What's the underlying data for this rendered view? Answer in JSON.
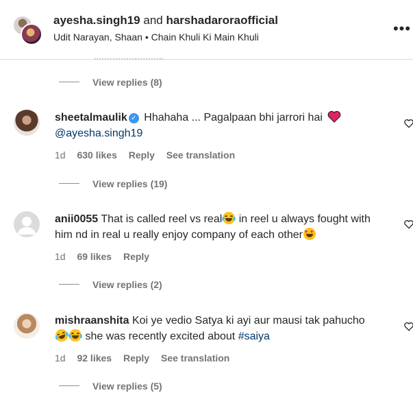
{
  "header": {
    "user1": "ayesha.singh19",
    "connector": "and",
    "user2": "harshadaroraofficial",
    "audio": "Udit Narayan, Shaan • Chain Khuli Ki Main Khuli",
    "more_icon": "more-horizontal-icon"
  },
  "replies": [
    {
      "label": "View replies (8)"
    },
    {
      "label": "View replies (19)"
    },
    {
      "label": "View replies (2)"
    },
    {
      "label": "View replies (5)"
    }
  ],
  "comments": [
    {
      "username": "sheetalmaulik",
      "verified": true,
      "text": "Hhahaha ... Pagalpaan bhi jarrori hai",
      "mention": "@ayesha.singh19",
      "age": "1d",
      "likes": "630 likes",
      "reply": "Reply",
      "translation": "See translation"
    },
    {
      "username": "anii0055",
      "text1": "That is called reel vs real",
      "text2": "in reel u always fought with him nd in real u really enjoy company of each other",
      "age": "1d",
      "likes": "69 likes",
      "reply": "Reply"
    },
    {
      "username": "mishraanshita",
      "text1": "Koi ye vedio Satya ki ayi aur mausi tak pahucho",
      "text2": "she was recently excited about",
      "hashtag": "#saiya",
      "age": "1d",
      "likes": "92 likes",
      "reply": "Reply",
      "translation": "See translation"
    }
  ],
  "colors": {
    "text": "#262626",
    "secondary": "#737373",
    "link": "#00376b",
    "verified": "#3897f0",
    "heart": "#e0245e"
  }
}
